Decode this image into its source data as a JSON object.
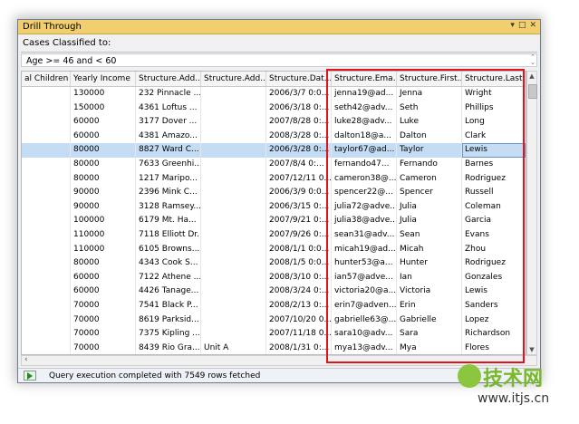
{
  "window": {
    "title": "Drill Through",
    "buttons": [
      "▾",
      "□",
      "✕"
    ]
  },
  "cases_label": "Cases Classified to:",
  "filter_text": "Age >= 46 and < 60",
  "grid": {
    "columns": [
      "al Children",
      "Yearly Income",
      "Structure.Add...",
      "Structure.Add...",
      "Structure.Dat...",
      "Structure.Ema...",
      "Structure.First...",
      "Structure.Last..."
    ],
    "selected_row": 4,
    "rows": [
      [
        "",
        "130000",
        "232 Pinnacle ...",
        "",
        "2006/3/7 0:0...",
        "jenna19@ad...",
        "Jenna",
        "Wright"
      ],
      [
        "",
        "150000",
        "4361 Loftus ...",
        "",
        "2006/3/18 0:...",
        "seth42@adv...",
        "Seth",
        "Phillips"
      ],
      [
        "",
        "60000",
        "3177 Dover ...",
        "",
        "2007/8/28 0:...",
        "luke28@adv...",
        "Luke",
        "Long"
      ],
      [
        "",
        "60000",
        "4381 Amazo...",
        "",
        "2008/3/28 0:...",
        "dalton18@a...",
        "Dalton",
        "Clark"
      ],
      [
        "",
        "80000",
        "8827 Ward C...",
        "",
        "2006/3/28 0:...",
        "taylor67@ad...",
        "Taylor",
        "Lewis"
      ],
      [
        "",
        "80000",
        "7633 Greenhi...",
        "",
        "2007/8/4 0:...",
        "fernando47...",
        "Fernando",
        "Barnes"
      ],
      [
        "",
        "80000",
        "1217 Maripo...",
        "",
        "2007/12/11 0...",
        "cameron38@...",
        "Cameron",
        "Rodriguez"
      ],
      [
        "",
        "90000",
        "2396 Mink C...",
        "",
        "2006/3/9 0:0...",
        "spencer22@...",
        "Spencer",
        "Russell"
      ],
      [
        "",
        "90000",
        "3128 Ramsey...",
        "",
        "2006/3/15 0:...",
        "julia72@adve...",
        "Julia",
        "Coleman"
      ],
      [
        "",
        "100000",
        "6179 Mt. Ha...",
        "",
        "2007/9/21 0:...",
        "julia38@adve...",
        "Julia",
        "Garcia"
      ],
      [
        "",
        "110000",
        "7118 Elliott Dr.",
        "",
        "2007/9/26 0:...",
        "sean31@adv...",
        "Sean",
        "Evans"
      ],
      [
        "",
        "110000",
        "6105 Browns...",
        "",
        "2008/1/1 0:0...",
        "micah19@ad...",
        "Micah",
        "Zhou"
      ],
      [
        "",
        "80000",
        "4343 Cook S...",
        "",
        "2008/1/5 0:0...",
        "hunter53@a...",
        "Hunter",
        "Rodriguez"
      ],
      [
        "",
        "60000",
        "7122 Athene ...",
        "",
        "2008/3/10 0:...",
        "ian57@adve...",
        "Ian",
        "Gonzales"
      ],
      [
        "",
        "60000",
        "4426 Tanage...",
        "",
        "2008/3/24 0:...",
        "victoria20@a...",
        "Victoria",
        "Lewis"
      ],
      [
        "",
        "70000",
        "7541 Black P...",
        "",
        "2008/2/13 0:...",
        "erin7@adven...",
        "Erin",
        "Sanders"
      ],
      [
        "",
        "70000",
        "8619 Parksid...",
        "",
        "2007/10/20 0...",
        "gabrielle63@...",
        "Gabrielle",
        "Lopez"
      ],
      [
        "",
        "70000",
        "7375 Kipling ...",
        "",
        "2007/11/18 0...",
        "sara10@adv...",
        "Sara",
        "Richardson"
      ],
      [
        "",
        "70000",
        "8439 Rio Gra...",
        "Unit A",
        "2008/1/31 0:...",
        "mya13@adv...",
        "Mya",
        "Flores"
      ]
    ]
  },
  "status_text": "Query execution completed with 7549 rows fetched",
  "watermark": {
    "text": "技术网",
    "url": "www.itjs.cn"
  },
  "colors": {
    "titlebar": "#f1cf6e",
    "selection": "#c4ddf5",
    "highlight": "#e3131b"
  }
}
